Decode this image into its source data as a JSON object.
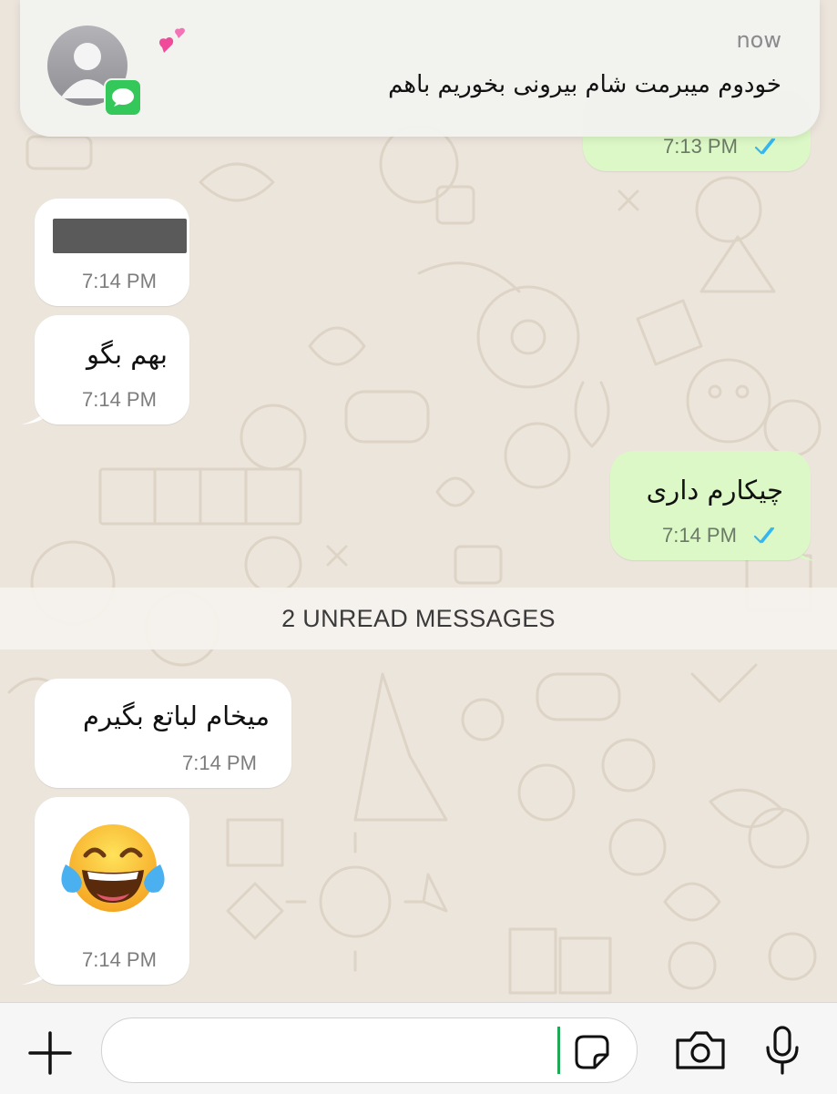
{
  "notification": {
    "time": "now",
    "message": "خودوم میبرمت شام بیرونی بخوریم باهم",
    "app_icon": "messages-icon",
    "avatar_icon": "person-silhouette-icon",
    "emoji_icon": "two-hearts-icon"
  },
  "messages": [
    {
      "direction": "out",
      "timestamp": "7:13 PM",
      "status": "read"
    },
    {
      "direction": "in",
      "content": "redacted",
      "timestamp": "7:14 PM"
    },
    {
      "direction": "in",
      "text": "بهم بگو",
      "timestamp": "7:14 PM"
    },
    {
      "direction": "out",
      "text": "چیکارم داری",
      "timestamp": "7:14 PM",
      "status": "read"
    },
    {
      "direction": "in",
      "text": "میخام لباتع بگیرم",
      "timestamp": "7:14 PM"
    },
    {
      "direction": "in",
      "emoji": "😂",
      "timestamp": "7:14 PM"
    }
  ],
  "unread_divider": "2 UNREAD MESSAGES",
  "input_bar": {
    "text": "",
    "icons": [
      "plus-icon",
      "sticker-icon",
      "camera-icon",
      "microphone-icon"
    ]
  },
  "colors": {
    "outgoing_bubble": "#dcf8c6",
    "incoming_bubble": "#ffffff",
    "read_ticks": "#34b7f1",
    "chat_background": "#ece5dc"
  }
}
